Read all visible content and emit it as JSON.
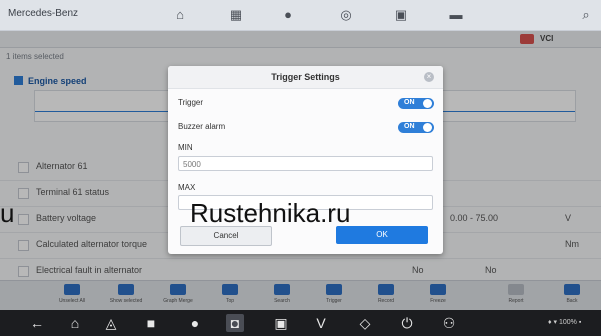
{
  "topbar": {
    "brand": "Mercedes-Benz"
  },
  "subbar": {
    "code": "VCI"
  },
  "list": {
    "selection_header": "1 items selected",
    "graph_title": "Engine speed",
    "rows": [
      {
        "label": "Alternator 61",
        "value": "",
        "unit": ""
      },
      {
        "label": "Terminal 61 status",
        "value": "",
        "unit": ""
      },
      {
        "label": "Battery voltage",
        "value": "0.00 - 75.00",
        "unit": "V"
      },
      {
        "label": "Calculated alternator torque",
        "value": "",
        "unit": "Nm"
      },
      {
        "label": "Electrical fault in alternator",
        "value": "No",
        "unit": "No"
      }
    ]
  },
  "dialog": {
    "title": "Trigger Settings",
    "close": "×",
    "trigger_label": "Trigger",
    "trigger_toggle": "ON",
    "buzzer_label": "Buzzer alarm",
    "buzzer_toggle": "ON",
    "min_label": "MIN",
    "min_value": "5000",
    "max_label": "MAX",
    "max_value": "",
    "cancel": "Cancel",
    "ok": "OK"
  },
  "watermark": {
    "left": "u",
    "site": "Rustehnika.ru"
  },
  "toolbar": [
    {
      "label": "Unselect All"
    },
    {
      "label": "Show selected"
    },
    {
      "label": "Graph Merge"
    },
    {
      "label": "Top"
    },
    {
      "label": "Search"
    },
    {
      "label": "Trigger"
    },
    {
      "label": "Record"
    },
    {
      "label": "Freeze"
    },
    {
      "label": "Report"
    },
    {
      "label": "Back"
    }
  ],
  "nav": {
    "status": "♦ ▾ 100% ▪"
  },
  "colors": {
    "accent": "#1f7ae0",
    "toolbar_icon": "#2f6fc4",
    "nav_bg": "#1c1d20"
  }
}
